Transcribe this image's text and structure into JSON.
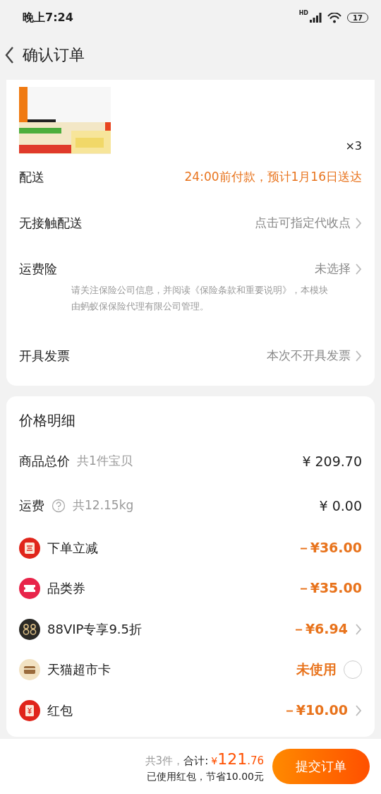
{
  "status_bar": {
    "time": "晚上7:24",
    "network": "HD",
    "battery": "17"
  },
  "header": {
    "title": "确认订单"
  },
  "product": {
    "kind": "picture",
    "quantity": "×3"
  },
  "order_options": [
    {
      "label": "配送",
      "value": "24:00前付款，预计1月16日送达",
      "highlight": true,
      "chevron": false
    },
    {
      "label": "无接触配送",
      "value": "点击可指定代收点",
      "highlight": false,
      "chevron": true
    },
    {
      "label": "运费险",
      "value": "未选择",
      "highlight": false,
      "chevron": true,
      "note": "请关注保险公司信息，并阅读《保险条款和重要说明》，本模块由蚂蚁保保险代理有限公司管理。"
    },
    {
      "label": "开具发票",
      "value": "本次不开具发票",
      "highlight": false,
      "chevron": true
    }
  ],
  "price_details": {
    "title": "价格明细",
    "rows": [
      {
        "kind": "plain",
        "label": "商品总价",
        "sub": "共1件宝贝",
        "amount": "¥ 209.70"
      },
      {
        "kind": "help",
        "label": "运费",
        "sub": "共12.15kg",
        "amount": "¥ 0.00"
      },
      {
        "kind": "cut",
        "label": "下单立减",
        "amount": "－¥36.00",
        "chevron": false
      },
      {
        "kind": "coupon",
        "label": "品类券",
        "amount": "－¥35.00",
        "chevron": false
      },
      {
        "kind": "vip",
        "label": "88VIP专享9.5折",
        "amount": "－¥6.94",
        "chevron": true
      },
      {
        "kind": "card",
        "label": "天猫超市卡",
        "amount": "未使用",
        "selected": false
      },
      {
        "kind": "packet",
        "label": "红包",
        "amount": "－¥10.00",
        "chevron": true
      }
    ]
  },
  "footer": {
    "count": "共3件，",
    "total_label": "合计:",
    "currency": "¥",
    "total_int": "121",
    "total_dec": ".76",
    "savings": "已使用红包，节省10.00元",
    "submit": "提交订单"
  }
}
